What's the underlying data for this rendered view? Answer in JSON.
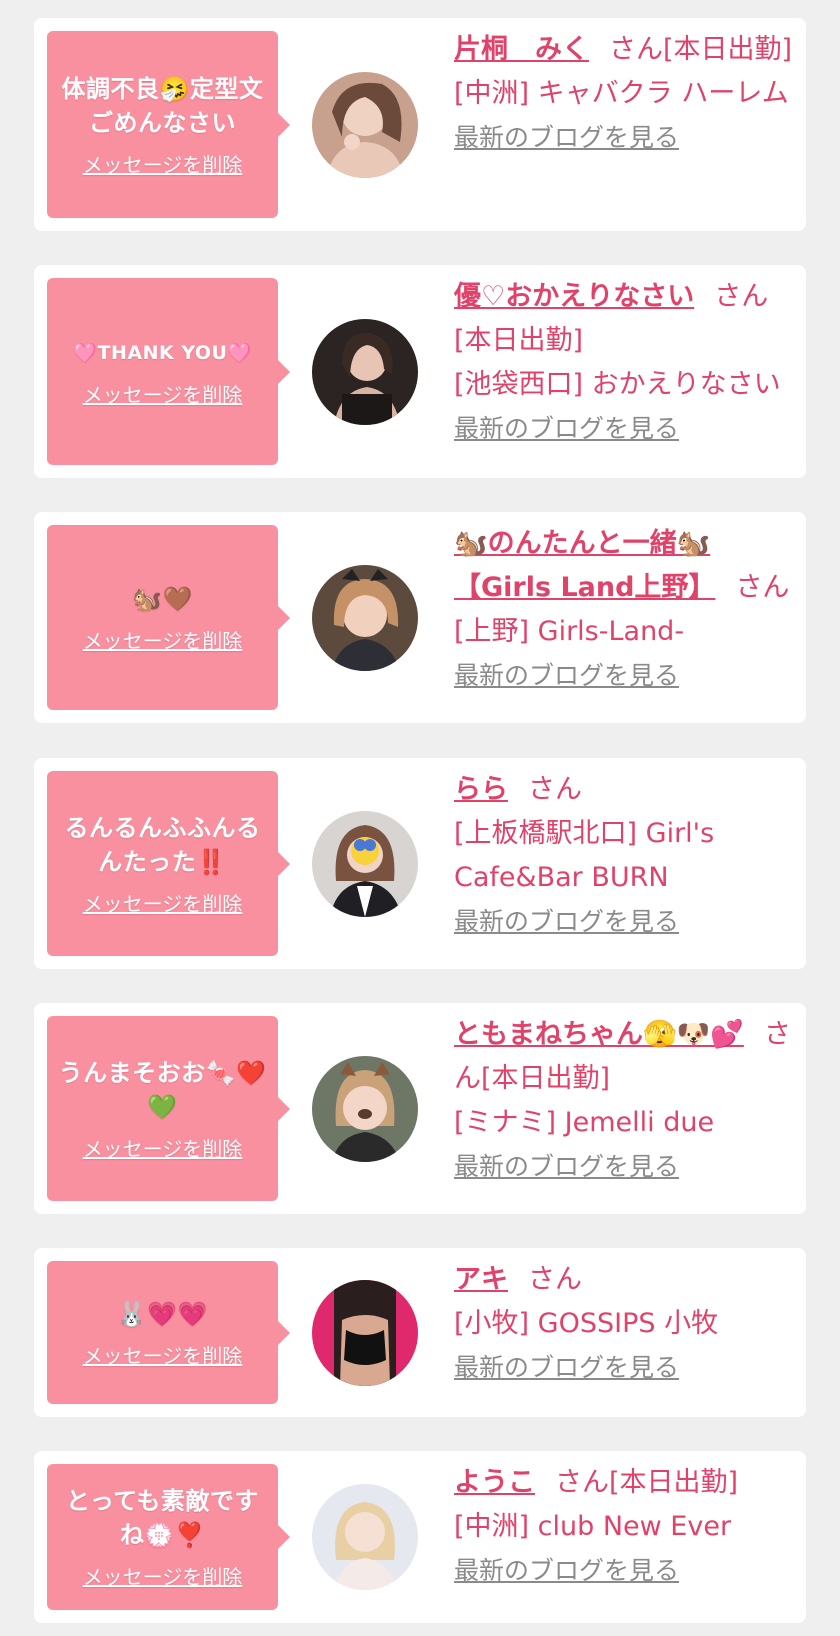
{
  "colors": {
    "page_bg": "#efefef",
    "card_bg": "#ffffff",
    "bubble_bg": "#f8909f",
    "accent_pink": "#e0436a",
    "link_gray": "#8a8a8a"
  },
  "common": {
    "delete_label": "メッセージを削除",
    "blog_label": "最新のブログを見る"
  },
  "items": [
    {
      "message": "体調不良🤧定型文ごめんなさい",
      "name": "片桐　みく",
      "suffix": "さん[本日出勤]",
      "shop": "[中洲] キャバクラ ハーレム",
      "avatar_icon": "avatar-photo"
    },
    {
      "message": "🩷THANK YOU🩷",
      "name": "優♡おかえりなさい",
      "suffix": "さん[本日出勤]",
      "shop": "[池袋西口] おかえりなさい",
      "avatar_icon": "avatar-photo"
    },
    {
      "message": "🐿️🤎",
      "name": "🐿️のんたんと一緒🐿️【Girls Land上野】",
      "suffix": "さん",
      "shop": "[上野] Girls-Land-",
      "avatar_icon": "avatar-photo"
    },
    {
      "message": "るんるんふふんるんたった‼️",
      "name": "らら",
      "suffix": "さん",
      "shop": "[上板橋駅北口] Girl's Cafe&Bar BURN",
      "avatar_icon": "avatar-photo"
    },
    {
      "message": "うんまそおお🍬❤️💚",
      "name": "ともまねちゃん🫣🐶💕",
      "suffix": "さん[本日出勤]",
      "shop": "[ミナミ] Jemelli due",
      "avatar_icon": "avatar-photo"
    },
    {
      "message": "🐰💗💗",
      "name": "アキ",
      "suffix": "さん",
      "shop": "[小牧] GOSSIPS 小牧",
      "avatar_icon": "avatar-photo"
    },
    {
      "message": "とっても素敵ですね💮❣️",
      "name": "ようこ",
      "suffix": "さん[本日出勤]",
      "shop": "[中洲] club New Ever",
      "avatar_icon": "avatar-photo"
    }
  ]
}
